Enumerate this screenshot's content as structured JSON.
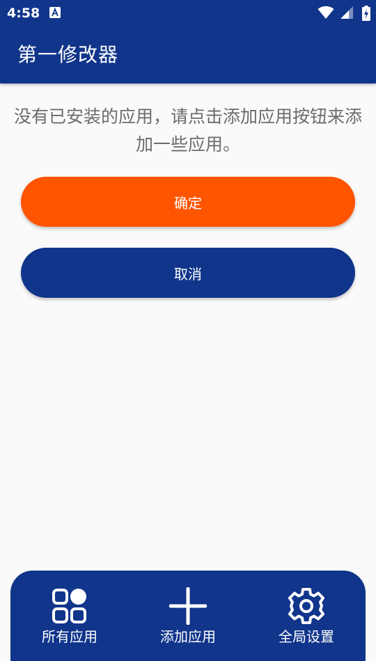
{
  "status_bar": {
    "time": "4:58",
    "notification_icon": "a-letter-icon",
    "right_icons": [
      "wifi-icon",
      "cellular-signal-icon",
      "battery-charging-icon"
    ]
  },
  "app_bar": {
    "title": "第一修改器"
  },
  "main": {
    "empty_message": "没有已安装的应用，请点击添加应用按钮来添加一些应用。",
    "confirm_label": "确定",
    "cancel_label": "取消"
  },
  "bottom_nav": {
    "items": [
      {
        "label": "所有应用",
        "icon": "grid-apps-icon"
      },
      {
        "label": "添加应用",
        "icon": "plus-icon"
      },
      {
        "label": "全局设置",
        "icon": "gear-icon"
      }
    ]
  },
  "colors": {
    "primary": "#11358b",
    "accent": "#ff5500",
    "background": "#fafafa",
    "message_text": "#6b6b6b"
  }
}
